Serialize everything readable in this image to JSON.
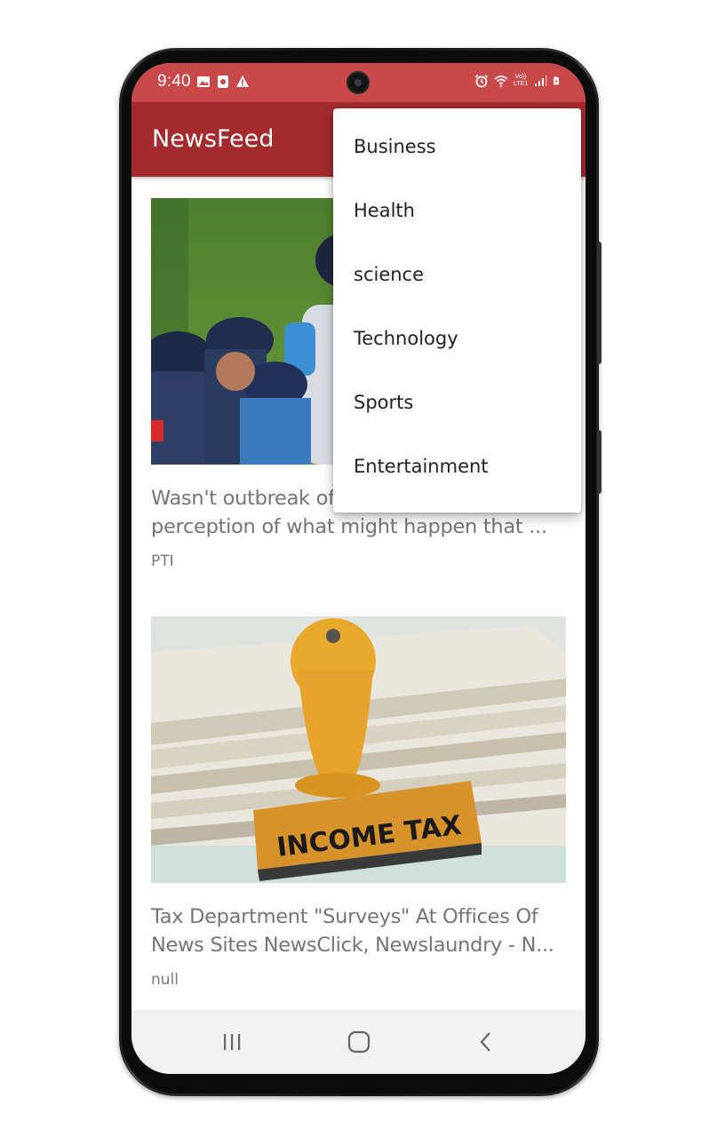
{
  "status_bar": {
    "time": "9:40",
    "left_icons": [
      "image-icon",
      "media-icon",
      "warning-icon"
    ],
    "right_icons": [
      "alarm-icon",
      "wifi-icon",
      "volte-icon",
      "signal-icon",
      "battery-icon"
    ],
    "volte_label": "Vo)) LTE1"
  },
  "toolbar": {
    "title": "NewsFeed",
    "background": "#a32a2d"
  },
  "feed": {
    "articles": [
      {
        "title": "Wasn't outbreak of perception of what might happen that ...",
        "title_line1": "Wasn't outbreak of",
        "title_line2": "perception of what might happen that ...",
        "source": "PTI",
        "image": "cricket-players-photo"
      },
      {
        "title": "Tax Department \"Surveys\" At Offices Of News Sites NewsClick, Newslaundry - N...",
        "title_line1": "Tax Department \"Surveys\" At Offices Of",
        "title_line2": "News Sites NewsClick, Newslaundry - N...",
        "source": "null",
        "image": "income-tax-stamp-photo",
        "stamp_text": "INCOME TAX"
      }
    ]
  },
  "menu": {
    "items": [
      {
        "label": "Business"
      },
      {
        "label": "Health"
      },
      {
        "label": "science"
      },
      {
        "label": "Technology"
      },
      {
        "label": "Sports"
      },
      {
        "label": "Entertainment"
      }
    ]
  },
  "nav_bar": {
    "buttons": [
      "recents-icon",
      "home-icon",
      "back-icon"
    ]
  },
  "colors": {
    "status_bar": "#c9494a",
    "toolbar": "#a32a2d",
    "text_secondary": "#757575"
  }
}
